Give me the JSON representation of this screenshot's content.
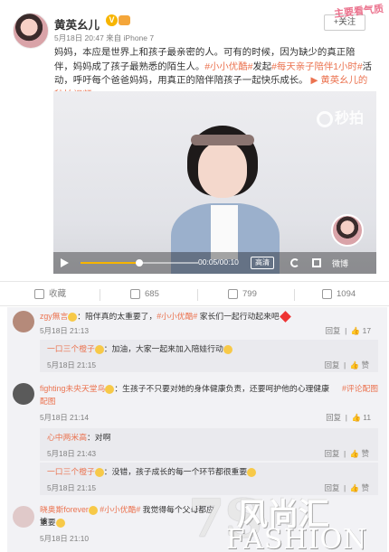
{
  "watermark_top": "主要看气质",
  "post": {
    "user_name": "黄英幺儿",
    "meta": "5月18日 20:47 来自 iPhone 7",
    "follow_label": "+关注",
    "text_1": "妈妈，本应是世界上和孩子最亲密的人。可有的时候，因为缺少的真正陪伴，妈妈成了孩子最熟悉的陌生人。",
    "tag_1": "#小小优酷#",
    "text_2": "发起",
    "tag_2": "#每天亲子陪伴1小时#",
    "text_3": "活动，呼吁每个爸爸妈妈，用真正的陪伴陪孩子一起快乐成长。",
    "link": "黄英幺儿的秒拍视频"
  },
  "video": {
    "logo_label": "秒拍",
    "time": "00:05/00:10",
    "hd_label": "高清",
    "weibo_label": "微博",
    "progress": 0.5
  },
  "actions": {
    "favorite": "收藏",
    "repost": "685",
    "comment": "799",
    "like": "1094"
  },
  "comments": [
    {
      "nick": "zgy無言",
      "text": "：陪伴真的太重要了，",
      "tag": "#小小优酷#",
      "text_after": " 家长们一起行动起来吧",
      "time": "5月18日 21:13",
      "reply_label": "回复",
      "likes": "17"
    },
    {
      "nick": "一口三个橙子",
      "text": "：加油，大家一起来加入陪娃行动",
      "time": "5月18日 21:15",
      "reply_label": "回复",
      "likes": "赞"
    },
    {
      "nick": "fighting未央天堂鸟",
      "text": "：生孩子不只要对她的身体健康负责，还要呵护他的心理健康",
      "text_extra": "配图",
      "tag": "#评论配图",
      "time": "5月18日 21:14",
      "reply_label": "回复",
      "likes": "11"
    },
    {
      "nick": "心中两米高",
      "text": "：对啊",
      "time": "5月18日 21:43",
      "reply_label": "回复",
      "likes": "赞"
    },
    {
      "nick": "一口三个橙子",
      "text": "：没错，孩子成长的每一个环节都很重要",
      "time": "5月18日 21:15",
      "reply_label": "回复",
      "likes": "赞"
    },
    {
      "nick": "晓奥斯forever",
      "tag": "#小小优酷#",
      "text": " 我觉得每个父母都应该",
      "text_2": "重要",
      "time": "5月18日 21:10"
    }
  ],
  "brand": {
    "mark": "7S",
    "cn": "风尚汇",
    "en": "FASHION"
  }
}
